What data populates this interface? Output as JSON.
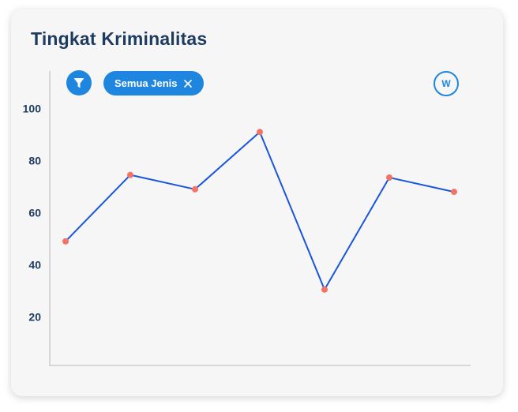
{
  "card": {
    "title": "Tingkat Kriminalitas"
  },
  "toolbar": {
    "filter_icon": "filter-icon",
    "chip_label": "Semua Jenis",
    "chip_close_icon": "close-icon",
    "w_label": "W"
  },
  "colors": {
    "accent": "#1f86e0",
    "line": "#1a56db",
    "point": "#f47366",
    "title": "#1d3a5f",
    "axis": "#d6d6d6"
  },
  "chart_data": {
    "type": "line",
    "title": "",
    "xlabel": "",
    "ylabel": "",
    "ylim": [
      0,
      115
    ],
    "yticks": [
      20,
      40,
      60,
      80,
      100
    ],
    "grid": false,
    "x": [
      1,
      2,
      3,
      4,
      5,
      6,
      7
    ],
    "series": [
      {
        "values": [
          49,
          74.5,
          69,
          91,
          30.5,
          73.5,
          68
        ]
      }
    ]
  }
}
